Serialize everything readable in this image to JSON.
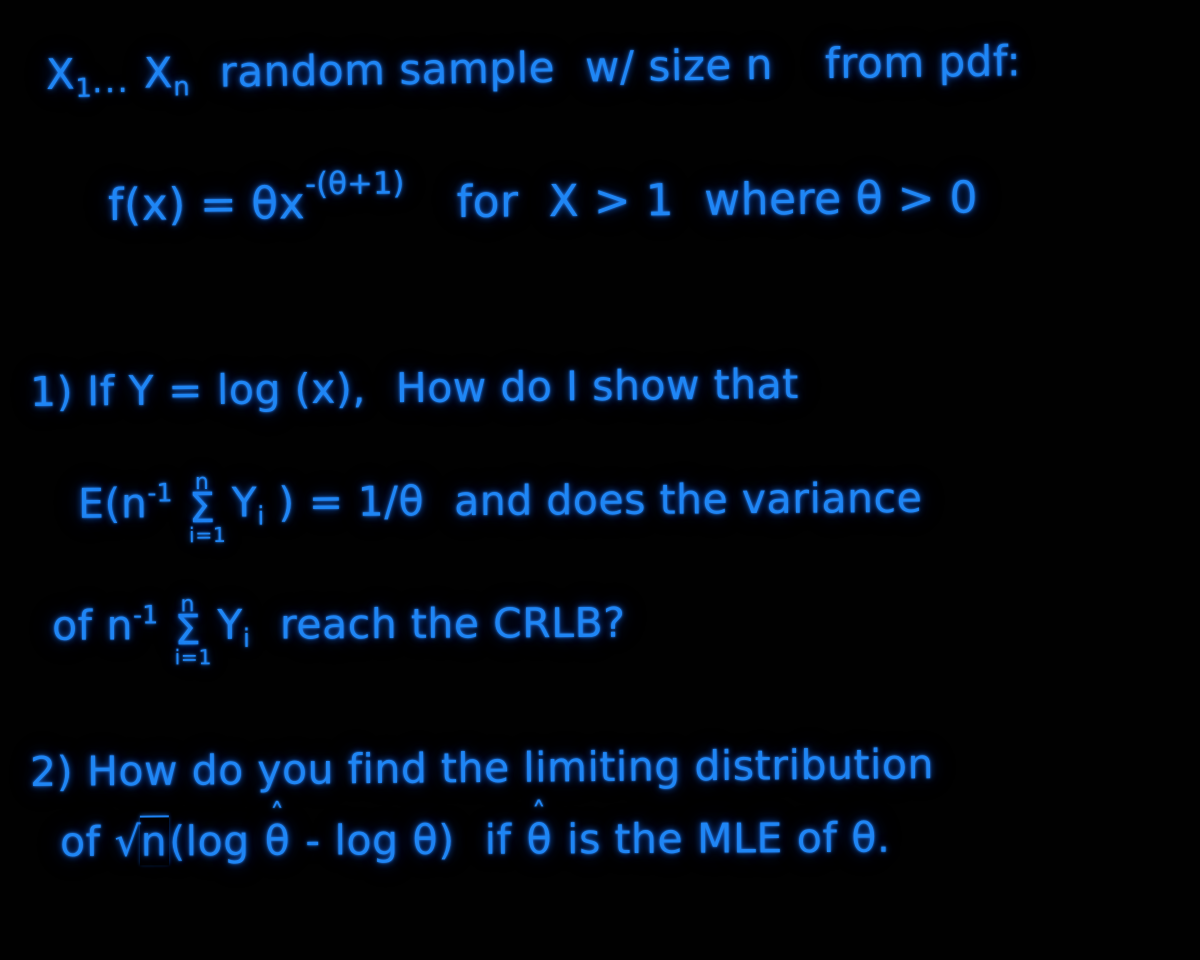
{
  "document": {
    "medium": "handwritten-whiteboard",
    "ink_color": "#1f86f5",
    "background_color": "#000000",
    "subject": "statistics-problem"
  },
  "preamble": {
    "line1": {
      "sample_var": "X",
      "sub_first": "1",
      "dots": "...",
      "sample_var2": "X",
      "sub_last": "n",
      "text_a": "random sample",
      "text_b": "w/ size",
      "var_n": "n",
      "text_c": "from pdf:"
    },
    "line2": {
      "fx": "f(x)",
      "equals": "=",
      "theta": "θ",
      "x": "x",
      "exponent": "-(θ+1)",
      "for_label": "for",
      "support": "X > 1",
      "where_label": "where",
      "param_condition": "θ > 0"
    }
  },
  "questions": [
    {
      "number": "1)",
      "line1": {
        "if_label": "If",
        "y": "Y",
        "equals": "=",
        "log_x": "log (x)",
        "comma": ",",
        "text": "How do I show that"
      },
      "line2": {
        "E": "E",
        "open_paren": "(",
        "n": "n",
        "n_exp": "-1",
        "sum_symbol": "Σ",
        "sum_upper": "n",
        "sum_lower": "i=1",
        "summand": "Y",
        "summand_sub": "i",
        "close_paren": ")",
        "equals": "=",
        "rhs": "1/θ",
        "text": "and does the variance"
      },
      "line3": {
        "of_label": "of",
        "n": "n",
        "n_exp": "-1",
        "sum_symbol": "Σ",
        "sum_upper": "n",
        "sum_lower": "i=1",
        "summand": "Y",
        "summand_sub": "i",
        "text": "reach the CRLB?"
      }
    },
    {
      "number": "2)",
      "line1": {
        "text": "How do you find the limiting distribution"
      },
      "line2": {
        "of_label": "of",
        "sqrt_symbol": "√",
        "radicand": "n",
        "open_paren": "(",
        "log1": "log",
        "theta_hat": "θ",
        "hat": "˄",
        "minus": "-",
        "log2": "log",
        "theta": "θ",
        "close_paren": ")",
        "if_label": "if",
        "theta_hat2": "θ",
        "is_the": "is the",
        "mle": "MLE",
        "of_label2": "of",
        "theta2": "θ",
        "period": "."
      }
    }
  ]
}
